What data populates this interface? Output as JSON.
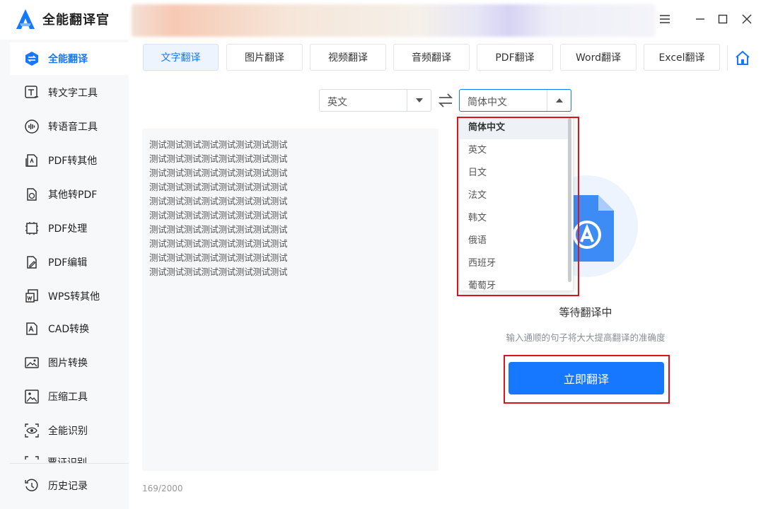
{
  "app": {
    "title": "全能翻译官",
    "accent": "#1677ff"
  },
  "sidebar": {
    "items": [
      {
        "label": "全能翻译",
        "icon": "translate-swap-icon",
        "active": true
      },
      {
        "label": "转文字工具",
        "icon": "text-convert-icon"
      },
      {
        "label": "转语音工具",
        "icon": "voice-wave-icon"
      },
      {
        "label": "PDF转其他",
        "icon": "pdf-export-icon"
      },
      {
        "label": "其他转PDF",
        "icon": "pdf-import-icon"
      },
      {
        "label": "PDF处理",
        "icon": "pdf-process-icon"
      },
      {
        "label": "PDF编辑",
        "icon": "pdf-edit-icon"
      },
      {
        "label": "WPS转其他",
        "icon": "wps-convert-icon"
      },
      {
        "label": "CAD转换",
        "icon": "cad-convert-icon"
      },
      {
        "label": "图片转换",
        "icon": "image-convert-icon"
      },
      {
        "label": "压缩工具",
        "icon": "compress-image-icon"
      },
      {
        "label": "全能识别",
        "icon": "eye-scan-icon"
      },
      {
        "label": "票证识别",
        "icon": "ticket-scan-icon"
      },
      {
        "label": "历史记录",
        "icon": "history-clock-icon"
      }
    ]
  },
  "tabs": [
    {
      "label": "文字翻译",
      "active": true
    },
    {
      "label": "图片翻译"
    },
    {
      "label": "视频翻译"
    },
    {
      "label": "音频翻译"
    },
    {
      "label": "PDF翻译"
    },
    {
      "label": "Word翻译"
    },
    {
      "label": "Excel翻译"
    }
  ],
  "language": {
    "source": "英文",
    "target": "简体中文",
    "options": [
      "简体中文",
      "英文",
      "日文",
      "法文",
      "韩文",
      "俄语",
      "西班牙",
      "葡萄牙"
    ],
    "selected_index": 0
  },
  "input": {
    "lines": [
      "测试测试测试测试测试测试测试测试",
      "测试测试测试测试测试测试测试测试",
      "测试测试测试测试测试测试测试测试",
      "测试测试测试测试测试测试测试测试",
      "测试测试测试测试测试测试测试测试",
      "测试测试测试测试测试测试测试测试",
      "测试测试测试测试测试测试测试测试",
      "测试测试测试测试测试测试测试测试",
      "测试测试测试测试测试测试测试测试",
      "测试测试测试测试测试测试测试测试"
    ],
    "char_count": "169/2000"
  },
  "result": {
    "status_title": "等待翻译中",
    "hint": "输入通顺的句子将大大提高翻译的准确度",
    "translate_button": "立即翻译"
  }
}
